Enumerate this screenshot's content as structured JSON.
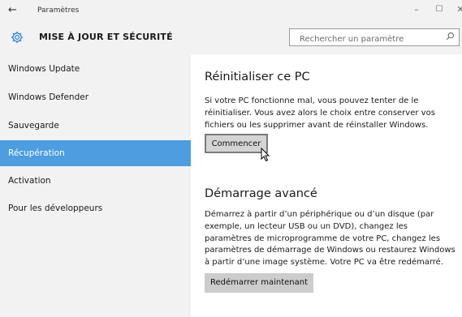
{
  "window": {
    "title": "Paramètres",
    "back_glyph": "←",
    "minimize_glyph": "–",
    "maximize_glyph": "☐",
    "close_glyph": "✕"
  },
  "header": {
    "icon": "gear-icon",
    "title": "MISE À JOUR ET SÉCURITÉ",
    "search_placeholder": "Rechercher un paramètre",
    "search_value": ""
  },
  "sidebar": {
    "items": [
      {
        "label": "Windows Update",
        "active": false
      },
      {
        "label": "Windows Defender",
        "active": false
      },
      {
        "label": "Sauvegarde",
        "active": false
      },
      {
        "label": "Récupération",
        "active": true
      },
      {
        "label": "Activation",
        "active": false
      },
      {
        "label": "Pour les développeurs",
        "active": false
      }
    ]
  },
  "main": {
    "reset": {
      "title": "Réinitialiser ce PC",
      "description": "Si votre PC fonctionne mal, vous pouvez tenter de le réinitialiser. Vous avez alors le choix entre conserver vos fichiers ou les supprimer avant de réinstaller Windows.",
      "button_label": "Commencer"
    },
    "advanced": {
      "title": "Démarrage avancé",
      "description": "Démarrez à partir d’un périphérique ou d’un disque (par exemple, un lecteur USB ou un DVD), changez les paramètres de microprogramme de votre PC, changez les paramètres de démarrage de Windows ou restaurez Windows à partir d’une image système. Votre PC va être redémarré.",
      "button_label": "Redémarrer maintenant"
    }
  },
  "colors": {
    "accent": "#4d9de0",
    "sidebar_bg": "#f2f2f2",
    "button_bg": "#cccccc"
  }
}
